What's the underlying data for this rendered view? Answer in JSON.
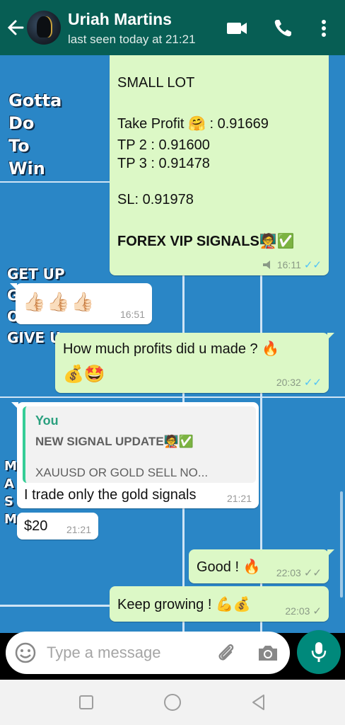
{
  "header": {
    "contact_name": "Uriah Martins",
    "status": "last seen today at 21:21",
    "icons": [
      "back-arrow-icon",
      "avatar",
      "video-call-icon",
      "phone-icon",
      "more-vert-icon"
    ]
  },
  "wallpaper": {
    "text_1": [
      "Gotta",
      "Do",
      "To",
      "Win"
    ],
    "text_2": [
      "GET UP",
      "G",
      "O",
      "GIVE U"
    ],
    "text_3": [
      "M",
      "A",
      "S",
      "M"
    ]
  },
  "messages": {
    "m1": {
      "lines": [
        "SMALL LOT",
        "Take Profit",
        ": 0.91669",
        "TP 2 : 0.91600",
        "TP 3 : 0.91478",
        "SL: 0.91978",
        "FOREX VIP SIGNALS"
      ],
      "emoji_hug": "🤗",
      "emoji_tail": "🧑‍🏫✅",
      "time": "16:11",
      "ticks": "✓✓"
    },
    "m2": {
      "emojis": "👍🏻👍🏻👍🏻",
      "time": "16:51"
    },
    "m3": {
      "text": "How much profits did u made ? 🔥",
      "emojis": "💰🤩",
      "time": "20:32",
      "ticks": "✓✓"
    },
    "m4": {
      "reply_author": "You",
      "reply_title": "NEW SIGNAL UPDATE🧑‍🏫✅",
      "reply_preview": "XAUUSD OR GOLD SELL NO...",
      "text": "I trade only the gold signals",
      "time": "21:21"
    },
    "m5": {
      "text": "$20",
      "time": "21:21"
    },
    "m6": {
      "text": "Good ! 🔥",
      "time": "22:03",
      "ticks": "✓✓"
    },
    "m7": {
      "text": "Keep growing ! 💪💰",
      "time": "22:03",
      "ticks": "✓"
    }
  },
  "input": {
    "placeholder": "Type a message"
  },
  "colors": {
    "header": "#075e54",
    "wallpaper": "#2a86c6",
    "outgoing": "#dcf8c6",
    "incoming": "#ffffff",
    "read_ticks": "#4fc3f7",
    "mic_button": "#00897b"
  }
}
